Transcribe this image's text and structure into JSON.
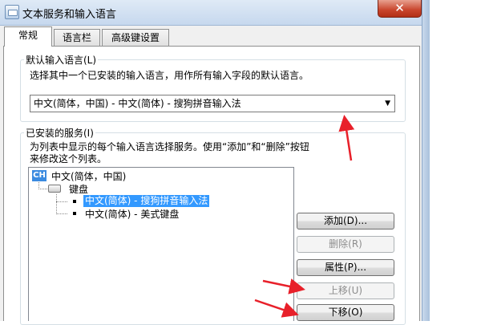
{
  "window": {
    "title": "文本服务和输入语言",
    "close_symbol": "✕"
  },
  "tabs": [
    {
      "label": "常规",
      "active": true
    },
    {
      "label": "语言栏",
      "active": false
    },
    {
      "label": "高级键设置",
      "active": false
    }
  ],
  "default_language": {
    "group_label": "默认输入语言(L)",
    "description": "选择其中一个已安装的输入语言，用作所有输入字段的默认语言。",
    "selected": "中文(简体，中国) - 中文(简体) - 搜狗拼音输入法",
    "arrow": "▼"
  },
  "installed_services": {
    "group_label": "已安装的服务(I)",
    "description_line1": "为列表中显示的每个输入语言选择服务。使用“添加”和“删除”按钮",
    "description_line2": "来修改这个列表。",
    "tree": {
      "language_badge": "CH",
      "language": "中文(简体，中国)",
      "category": "键盘",
      "items": [
        {
          "label": "中文(简体) - 搜狗拼音输入法",
          "selected": true
        },
        {
          "label": "中文(简体) - 美式键盘",
          "selected": false
        }
      ]
    }
  },
  "buttons": {
    "add": "添加(D)...",
    "remove": "删除(R)",
    "properties": "属性(P)...",
    "move_up": "上移(U)",
    "move_down": "下移(O)"
  },
  "annotation_color": "#e8202a"
}
